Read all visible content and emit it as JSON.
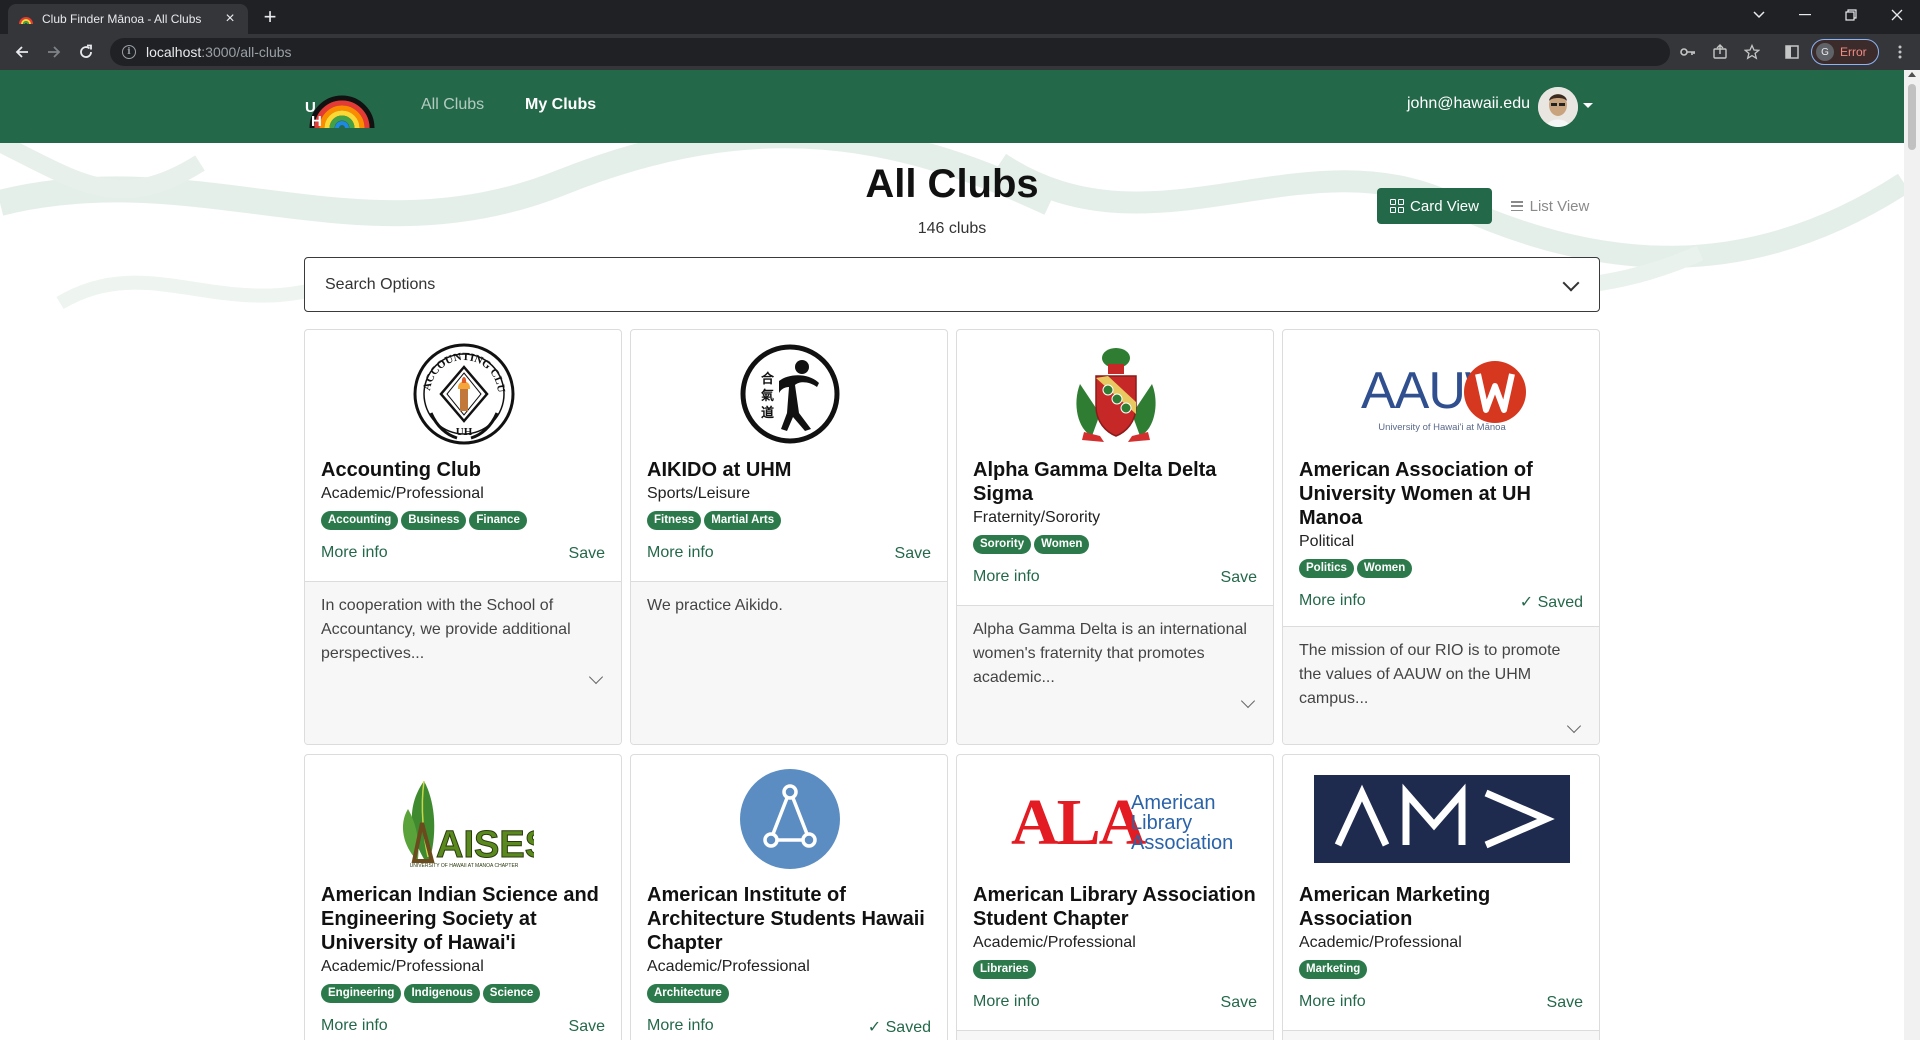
{
  "browser": {
    "tab_title": "Club Finder Mānoa - All Clubs",
    "url_host": "localhost",
    "url_path": ":3000/all-clubs",
    "profile_initial": "G",
    "profile_status": "Error"
  },
  "navbar": {
    "links": [
      "All Clubs",
      "My Clubs"
    ],
    "user_email": "john@hawaii.edu",
    "brand_color": "#24684a"
  },
  "header": {
    "title": "All Clubs",
    "count": "146 clubs",
    "card_view_label": "Card View",
    "list_view_label": "List View"
  },
  "search": {
    "label": "Search Options"
  },
  "clubs": [
    {
      "name": "Accounting Club",
      "type": "Academic/Professional",
      "tags": [
        "Accounting",
        "Business",
        "Finance"
      ],
      "more_info": "More info",
      "save_label": "Save",
      "description": "In cooperation with the School of Accountancy, we provide additional perspectives..."
    },
    {
      "name": "AIKIDO at UHM",
      "type": "Sports/Leisure",
      "tags": [
        "Fitness",
        "Martial Arts"
      ],
      "more_info": "More info",
      "save_label": "Save",
      "description": "We practice Aikido."
    },
    {
      "name": "Alpha Gamma Delta Delta Sigma",
      "type": "Fraternity/Sorority",
      "tags": [
        "Sorority",
        "Women"
      ],
      "more_info": "More info",
      "save_label": "Save",
      "description": "Alpha Gamma Delta is an international women's fraternity that promotes academic..."
    },
    {
      "name": "American Association of University Women at UH Manoa",
      "type": "Political",
      "tags": [
        "Politics",
        "Women"
      ],
      "more_info": "More info",
      "save_label": "✓ Saved",
      "description": "The mission of our RIO is to promote the values of AAUW on the UHM campus..."
    },
    {
      "name": "American Indian Science and Engineering Society at University of Hawai'i",
      "type": "Academic/Professional",
      "tags": [
        "Engineering",
        "Indigenous",
        "Science"
      ],
      "more_info": "More info",
      "save_label": "Save"
    },
    {
      "name": "American Institute of Architecture Students Hawaii Chapter",
      "type": "Academic/Professional",
      "tags": [
        "Architecture"
      ],
      "more_info": "More info",
      "save_label": "✓ Saved"
    },
    {
      "name": "American Library Association Student Chapter",
      "type": "Academic/Professional",
      "tags": [
        "Libraries"
      ],
      "more_info": "More info",
      "save_label": "Save"
    },
    {
      "name": "American Marketing Association",
      "type": "Academic/Professional",
      "tags": [
        "Marketing"
      ],
      "more_info": "More info",
      "save_label": "Save"
    }
  ],
  "logos": {
    "accounting_ring_text": "ACCOUNTING CLUB",
    "accounting_bottom": "UH",
    "aauw_text": "AAUW",
    "aauw_sub": "University of Hawai'i at Mānoa",
    "aises_text": "AISES",
    "aises_sub": "UNIVERSITY OF HAWAII AT MANOA CHAPTER",
    "ala_text": "ALA",
    "ala_sub1": "American",
    "ala_sub2": "Library",
    "ala_sub3": "Association",
    "ama_text": "AM>",
    "aikido_kanji": "合氣道"
  }
}
